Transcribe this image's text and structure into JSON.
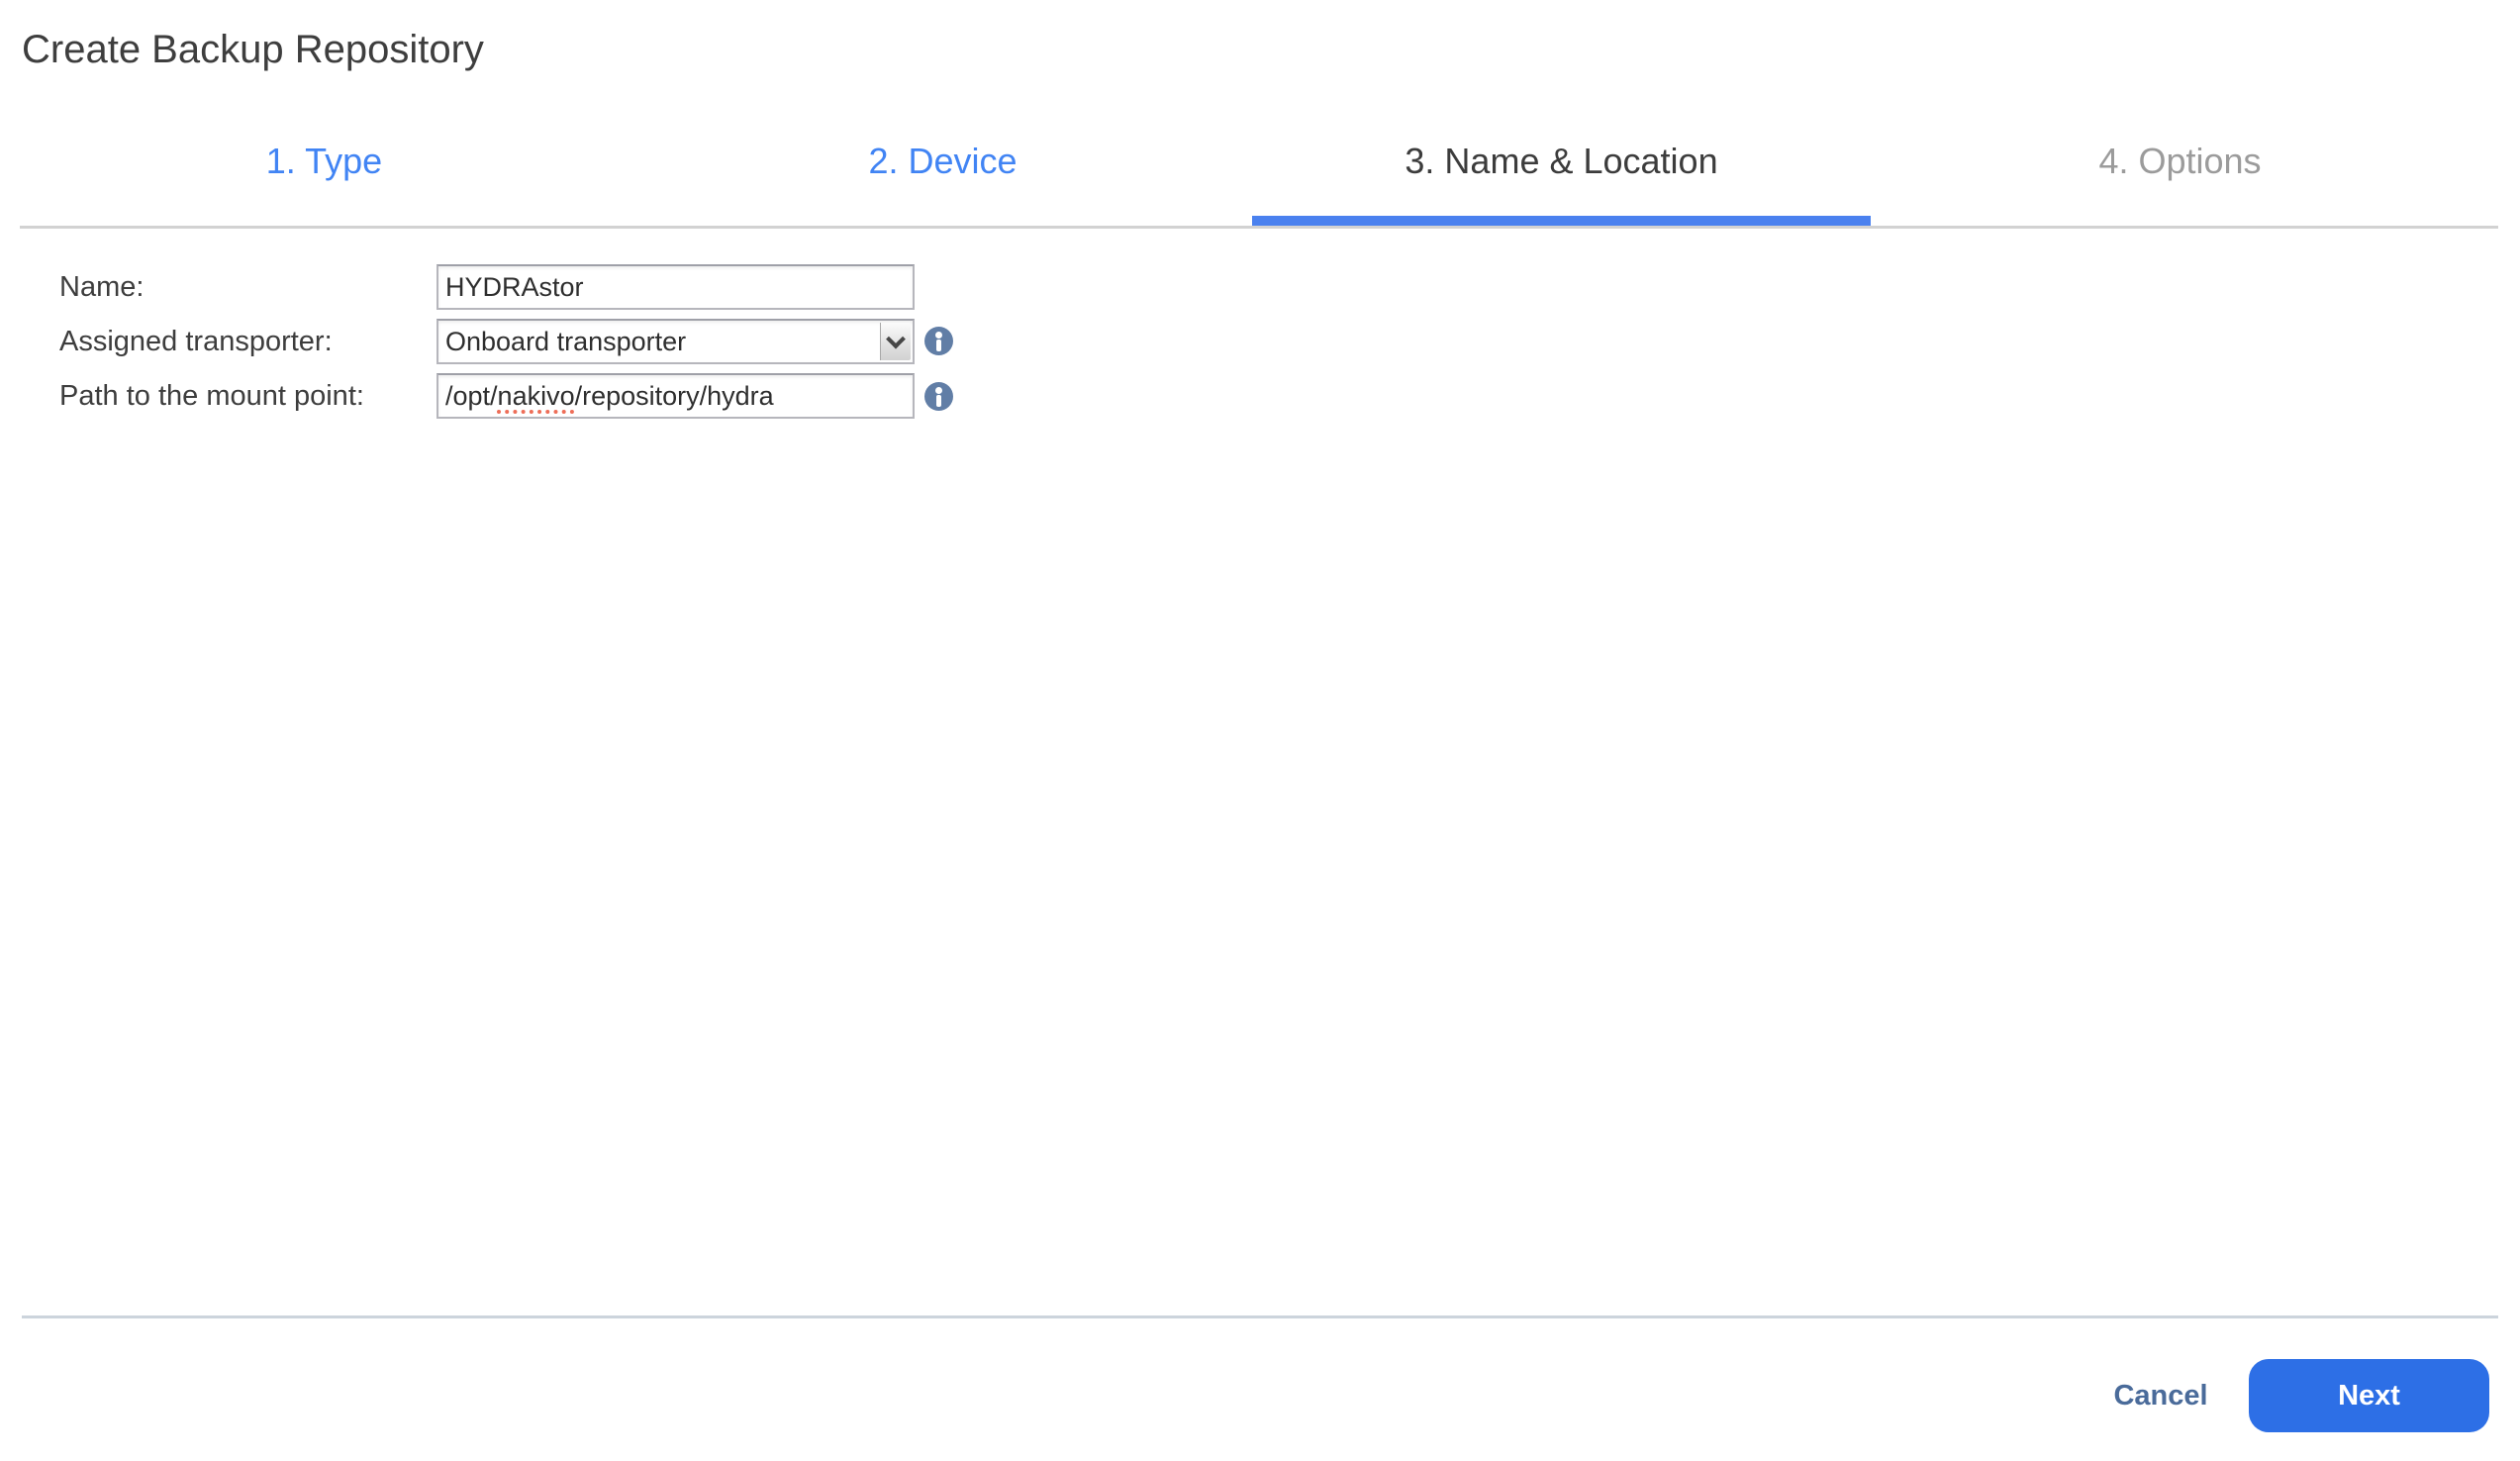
{
  "dialog": {
    "title": "Create Backup Repository"
  },
  "wizard": {
    "steps": [
      {
        "label": "1. Type",
        "state": "completed"
      },
      {
        "label": "2. Device",
        "state": "completed"
      },
      {
        "label": "3. Name & Location",
        "state": "active"
      },
      {
        "label": "4. Options",
        "state": "upcoming"
      }
    ],
    "active_step_index": 2
  },
  "form": {
    "fields": [
      {
        "label": "Name:",
        "type": "text",
        "value": "HYDRAstor"
      },
      {
        "label": "Assigned transporter:",
        "type": "select",
        "value": "Onboard transporter",
        "has_info": true
      },
      {
        "label": "Path to the mount point:",
        "type": "text",
        "value": "/opt/nakivo/repository/hydra",
        "segments": {
          "pre": "/opt/",
          "misspelled": "nakivo",
          "post": "/repository/hydra"
        },
        "has_info": true
      }
    ]
  },
  "icons": {
    "info_glyph": "i",
    "select_dropdown": "chevron-down"
  },
  "footer": {
    "cancel": "Cancel",
    "next": "Next"
  },
  "colors": {
    "step_completed": "#4184f4",
    "step_active": "#3c3c3c",
    "step_upcoming": "#9b9b9b",
    "active_underline": "#4a81ef",
    "divider": "#d2d2d2",
    "footer_divider": "#ccd4dc",
    "next_button_bg": "#2d6fe6",
    "cancel_text": "#4a6b9a",
    "info_icon_bg": "#617ea6",
    "spellcheck_squiggle": "#ee6e58",
    "title_text": "#3e3e3e"
  }
}
